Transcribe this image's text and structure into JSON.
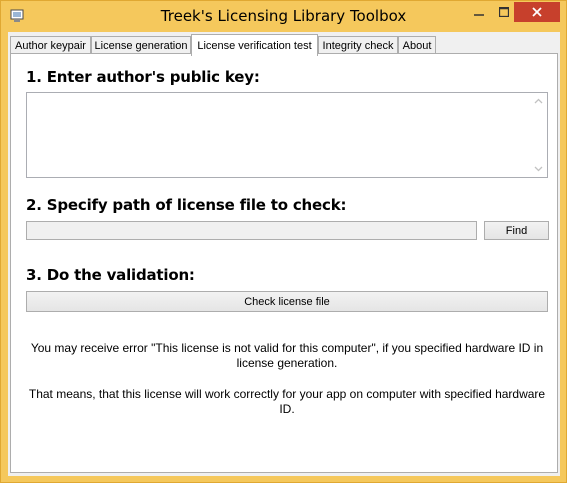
{
  "window": {
    "title": "Treek's Licensing Library Toolbox"
  },
  "tabs": [
    {
      "label": "Author keypair"
    },
    {
      "label": "License generation"
    },
    {
      "label": "License verification test",
      "active": true
    },
    {
      "label": "Integrity check"
    },
    {
      "label": "About"
    }
  ],
  "step1": {
    "heading": "1. Enter author's public key:",
    "value": ""
  },
  "step2": {
    "heading": "2. Specify path of license file to check:",
    "path_value": "",
    "find_label": "Find"
  },
  "step3": {
    "heading": "3. Do the validation:",
    "check_label": "Check license file"
  },
  "info": {
    "line1": "You may receive error \"This license is not valid for this computer\", if you specified hardware ID in license generation.",
    "line2": "That means, that this license will work correctly for your app on computer with specified hardware ID."
  },
  "icons": {
    "app": "app-icon",
    "minimize": "minimize-icon",
    "maximize": "maximize-icon",
    "close": "close-icon",
    "scroll_up": "scroll-up-icon",
    "scroll_down": "scroll-down-icon"
  },
  "colors": {
    "frame": "#f5c85c",
    "close": "#c7402c"
  }
}
